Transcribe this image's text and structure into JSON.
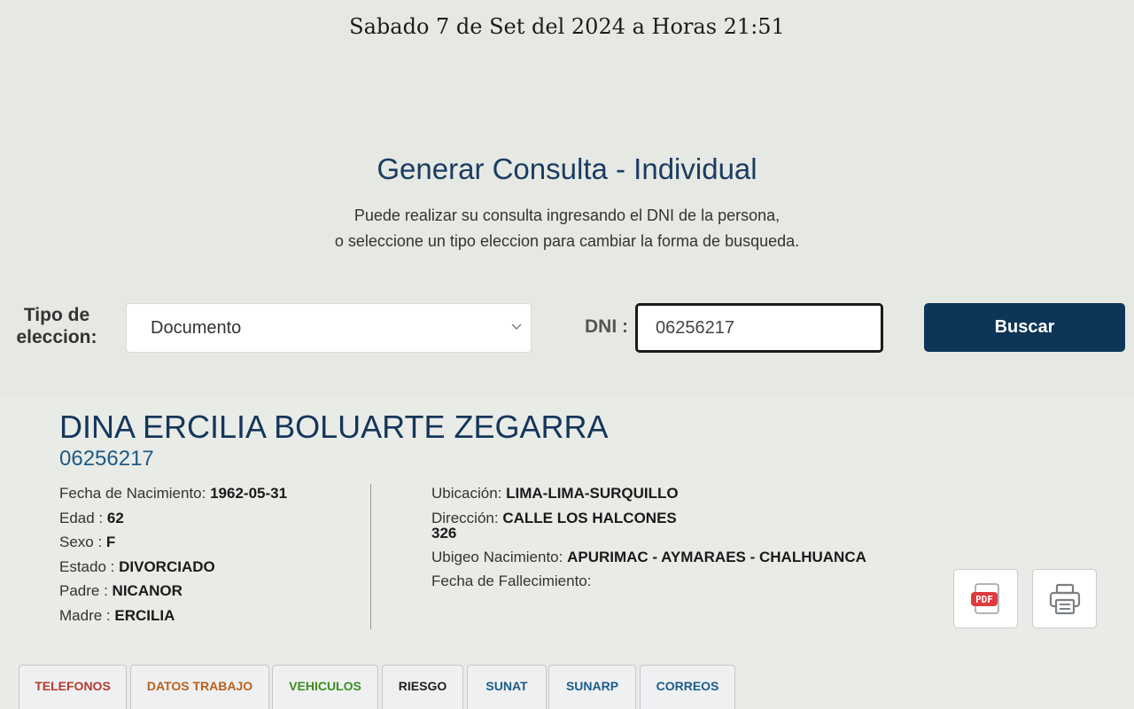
{
  "header": {
    "datetime": "Sabado 7 de Set del 2024 a Horas 21:51"
  },
  "form": {
    "title": "Generar Consulta - Individual",
    "subtitle_line1": "Puede realizar su consulta ingresando el DNI de la persona,",
    "subtitle_line2": "o seleccione un tipo eleccion para cambiar la forma de busqueda.",
    "tipo_label_line1": "Tipo de",
    "tipo_label_line2": "eleccion:",
    "tipo_selected": "Documento",
    "dni_label": "DNI :",
    "dni_value": "06256217",
    "search_button": "Buscar"
  },
  "person": {
    "name": "DINA ERCILIA BOLUARTE ZEGARRA",
    "dni": "06256217",
    "left": [
      {
        "label": "Fecha de Nacimiento: ",
        "value": "1962-05-31"
      },
      {
        "label": "Edad : ",
        "value": "62"
      },
      {
        "label": "Sexo : ",
        "value": "F"
      },
      {
        "label": "Estado : ",
        "value": "DIVORCIADO"
      },
      {
        "label": "Padre : ",
        "value": "NICANOR"
      },
      {
        "label": "Madre : ",
        "value": "ERCILIA"
      }
    ],
    "right": {
      "ubicacion_label": "Ubicación: ",
      "ubicacion_value": "LIMA-LIMA-SURQUILLO",
      "direccion_label": "Dirección: ",
      "direccion_value_line1": "CALLE LOS HALCONES",
      "direccion_value_line2": "326",
      "ubigeo_label": "Ubigeo Nacimiento: ",
      "ubigeo_value": "APURIMAC - AYMARAES - CHALHUANCA",
      "fallecimiento_label": "Fecha de Fallecimiento:"
    }
  },
  "actions": {
    "pdf_icon_text": "PDF"
  },
  "tabs": [
    {
      "label": "TELEFONOS",
      "color": "#b83a2e"
    },
    {
      "label": "DATOS TRABAJO",
      "color": "#b8621e"
    },
    {
      "label": "VEHICULOS",
      "color": "#3f8c1f"
    },
    {
      "label": "RIESGO",
      "color": "#1f1f1f"
    },
    {
      "label": "SUNAT",
      "color": "#1d5c8a"
    },
    {
      "label": "SUNARP",
      "color": "#1d5c8a"
    },
    {
      "label": "CORREOS",
      "color": "#1d5c8a"
    }
  ],
  "colors": {
    "primary": "#0d3558",
    "pdf_red": "#e03a3e"
  }
}
